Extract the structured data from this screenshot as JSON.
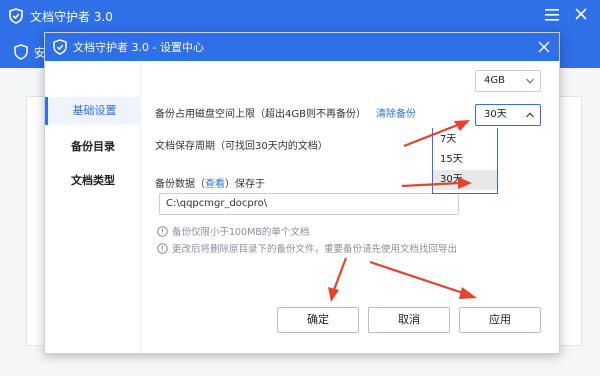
{
  "main_window": {
    "title": "文档守护者 3.0",
    "tab_label": "安"
  },
  "dialog": {
    "title": "文档守护者 3.0 - 设置中心"
  },
  "sidebar": {
    "items": [
      {
        "label": "基础设置"
      },
      {
        "label": "备份目录"
      },
      {
        "label": "文档类型"
      }
    ]
  },
  "settings": {
    "disk_limit": {
      "label": "备份占用磁盘空间上限（超出4GB则不再备份）",
      "clear_link": "清除备份",
      "value": "4GB"
    },
    "retention": {
      "label": "文档保存周期（可找回30天内的文档）",
      "value": "30天",
      "options": [
        "7天",
        "15天",
        "30天"
      ],
      "selected_index": 2
    },
    "backup_location": {
      "label_prefix": "备份数据（",
      "view_link": "查看",
      "label_suffix": "）保存于",
      "path": "C:\\qqpcmgr_docpro\\"
    },
    "notes": [
      "备份仅限小于100MB的单个文档",
      "更改后将删除原目录下的备份文件，重要备份请先使用文档找回导出"
    ]
  },
  "buttons": {
    "ok": "确定",
    "cancel": "取消",
    "apply": "应用"
  },
  "colors": {
    "accent": "#2f6fe8",
    "annotation_arrow": "#e8412f"
  }
}
